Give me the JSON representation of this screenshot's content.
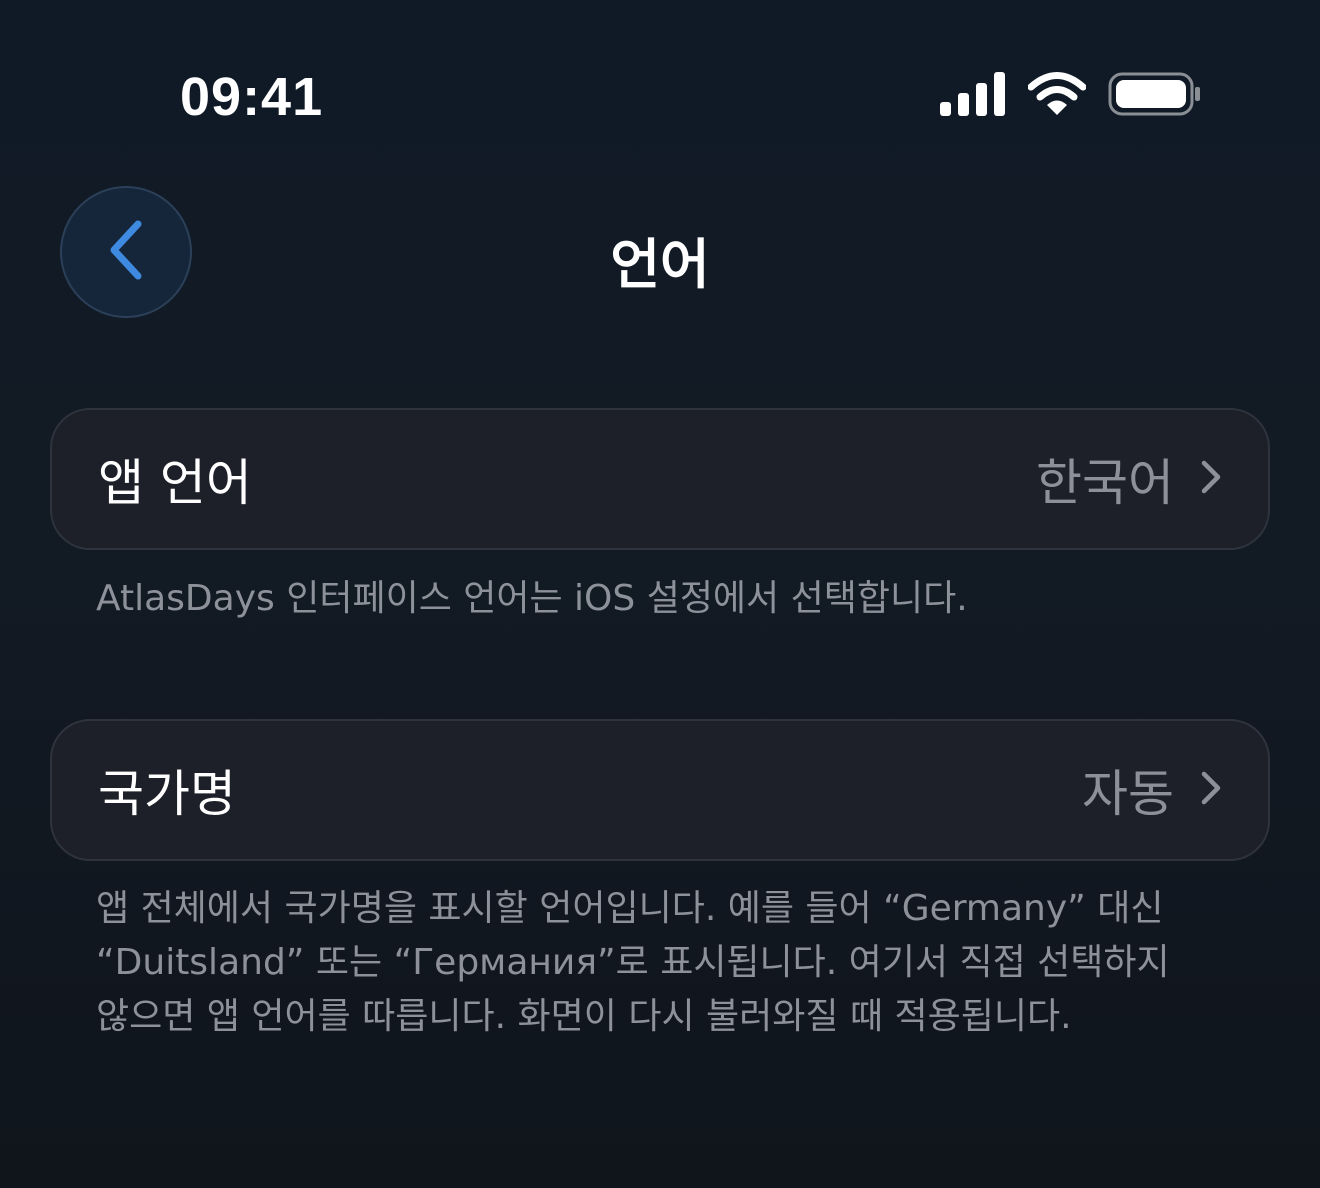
{
  "status_bar": {
    "time": "09:41",
    "icons": [
      "cellular-signal-icon",
      "wifi-icon",
      "battery-icon"
    ]
  },
  "nav": {
    "back_icon": "chevron-left-icon",
    "title": "언어"
  },
  "settings": [
    {
      "label": "앱 언어",
      "value": "한국어",
      "footnote": "AtlasDays 인터페이스 언어는 iOS 설정에서 선택합니다."
    },
    {
      "label": "국가명",
      "value": "자동",
      "footnote": "앱 전체에서 국가명을 표시할 언어입니다. 예를 들어 “Germany” 대신\n“Duitsland” 또는 “Германия”로 표시됩니다. 여기서 직접 선택하지\n않으면 앱 언어를 따릅니다. 화면이 다시 불러와질 때 적용됩니다."
    }
  ],
  "colors": {
    "background": "#111923",
    "row_background": "#1d2028",
    "accent": "#3d8ae0",
    "secondary_text": "#8d9098"
  }
}
